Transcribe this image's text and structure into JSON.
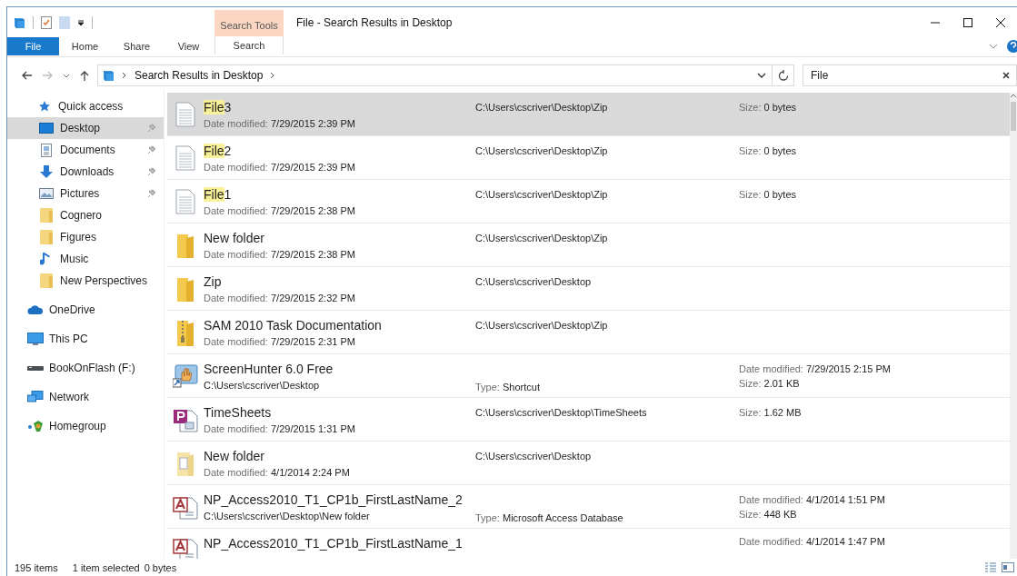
{
  "window": {
    "title": "File - Search Results in Desktop"
  },
  "ribbon": {
    "tabs": [
      {
        "label": "File",
        "kind": "file"
      },
      {
        "label": "Home",
        "kind": "normal"
      },
      {
        "label": "Share",
        "kind": "normal"
      },
      {
        "label": "View",
        "kind": "normal"
      },
      {
        "label": "Search",
        "kind": "contextual",
        "context": "Search Tools"
      }
    ]
  },
  "address_bar": {
    "location": "Search Results in Desktop"
  },
  "search": {
    "value": "File"
  },
  "sidebar": {
    "items": [
      {
        "label": "Quick access",
        "kind": "star",
        "selected": false,
        "children": [
          {
            "label": "Desktop",
            "kind": "desktop",
            "pinned": true,
            "selected": true
          },
          {
            "label": "Documents",
            "kind": "documents",
            "pinned": true,
            "selected": false
          },
          {
            "label": "Downloads",
            "kind": "downloads",
            "pinned": true,
            "selected": false
          },
          {
            "label": "Pictures",
            "kind": "pictures",
            "pinned": true,
            "selected": false
          },
          {
            "label": "Cognero",
            "kind": "folder",
            "pinned": false,
            "selected": false
          },
          {
            "label": "Figures",
            "kind": "folder",
            "pinned": false,
            "selected": false
          },
          {
            "label": "Music",
            "kind": "music",
            "pinned": false,
            "selected": false
          },
          {
            "label": "New Perspectives",
            "kind": "folder",
            "pinned": false,
            "selected": false
          }
        ]
      },
      {
        "label": "OneDrive",
        "kind": "cloud",
        "selected": false
      },
      {
        "label": "This PC",
        "kind": "pc",
        "selected": false
      },
      {
        "label": "BookOnFlash (F:)",
        "kind": "drive",
        "selected": false
      },
      {
        "label": "Network",
        "kind": "network",
        "selected": false
      },
      {
        "label": "Homegroup",
        "kind": "homegroup",
        "selected": false
      }
    ]
  },
  "results": [
    {
      "kind": "text",
      "highlight": "File",
      "name": "3",
      "selected": true,
      "detail": {
        "label": "Date modified:",
        "value": "7/29/2015 2:39 PM"
      },
      "middle": {
        "value": "C:\\Users\\cscriver\\Desktop\\Zip"
      },
      "right": [
        {
          "label": "Size:",
          "value": "0 bytes"
        }
      ]
    },
    {
      "kind": "text",
      "highlight": "File",
      "name": "2",
      "selected": false,
      "detail": {
        "label": "Date modified:",
        "value": "7/29/2015 2:39 PM"
      },
      "middle": {
        "value": "C:\\Users\\cscriver\\Desktop\\Zip"
      },
      "right": [
        {
          "label": "Size:",
          "value": "0 bytes"
        }
      ]
    },
    {
      "kind": "text",
      "highlight": "File",
      "name": "1",
      "selected": false,
      "detail": {
        "label": "Date modified:",
        "value": "7/29/2015 2:38 PM"
      },
      "middle": {
        "value": "C:\\Users\\cscriver\\Desktop\\Zip"
      },
      "right": [
        {
          "label": "Size:",
          "value": "0 bytes"
        }
      ]
    },
    {
      "kind": "folder",
      "name": "New folder",
      "selected": false,
      "detail": {
        "label": "Date modified:",
        "value": "7/29/2015 2:38 PM"
      },
      "middle": {
        "value": "C:\\Users\\cscriver\\Desktop\\Zip"
      }
    },
    {
      "kind": "folder",
      "name": "Zip",
      "selected": false,
      "detail": {
        "label": "Date modified:",
        "value": "7/29/2015 2:32 PM"
      },
      "middle": {
        "value": "C:\\Users\\cscriver\\Desktop"
      }
    },
    {
      "kind": "zip",
      "name": "SAM 2010 Task Documentation",
      "selected": false,
      "detail": {
        "label": "Date modified:",
        "value": "7/29/2015 2:31 PM"
      },
      "middle": {
        "value": "C:\\Users\\cscriver\\Desktop\\Zip"
      }
    },
    {
      "kind": "shortcut",
      "name": "ScreenHunter 6.0 Free",
      "selected": false,
      "detail": {
        "value": "C:\\Users\\cscriver\\Desktop"
      },
      "middle": {
        "label": "Type:",
        "value": "Shortcut"
      },
      "right": [
        {
          "label": "Date modified:",
          "value": "7/29/2015 2:15 PM"
        },
        {
          "label": "Size:",
          "value": "2.01 KB"
        }
      ]
    },
    {
      "kind": "publisher",
      "name": "TimeSheets",
      "selected": false,
      "detail": {
        "label": "Date modified:",
        "value": "7/29/2015 1:31 PM"
      },
      "middle": {
        "value": "C:\\Users\\cscriver\\Desktop\\TimeSheets"
      },
      "right": [
        {
          "label": "Size:",
          "value": "1.62 MB"
        }
      ]
    },
    {
      "kind": "folder-doc",
      "name": "New folder",
      "selected": false,
      "detail": {
        "label": "Date modified:",
        "value": "4/1/2014 2:24 PM"
      },
      "middle": {
        "value": "C:\\Users\\cscriver\\Desktop"
      }
    },
    {
      "kind": "access",
      "name": "NP_Access2010_T1_CP1b_FirstLastName_2",
      "selected": false,
      "detail": {
        "value": "C:\\Users\\cscriver\\Desktop\\New folder"
      },
      "middle": {
        "label": "Type:",
        "value": "Microsoft Access Database"
      },
      "right": [
        {
          "label": "Date modified:",
          "value": "4/1/2014 1:51 PM"
        },
        {
          "label": "Size:",
          "value": "448 KB"
        }
      ]
    },
    {
      "kind": "access",
      "name": "NP_Access2010_T1_CP1b_FirstLastName_1",
      "selected": false,
      "right": [
        {
          "label": "Date modified:",
          "value": "4/1/2014 1:47 PM"
        }
      ]
    }
  ],
  "status_bar": {
    "item_count": "195 items",
    "selection": "1 item selected",
    "selection_size": "0 bytes"
  }
}
